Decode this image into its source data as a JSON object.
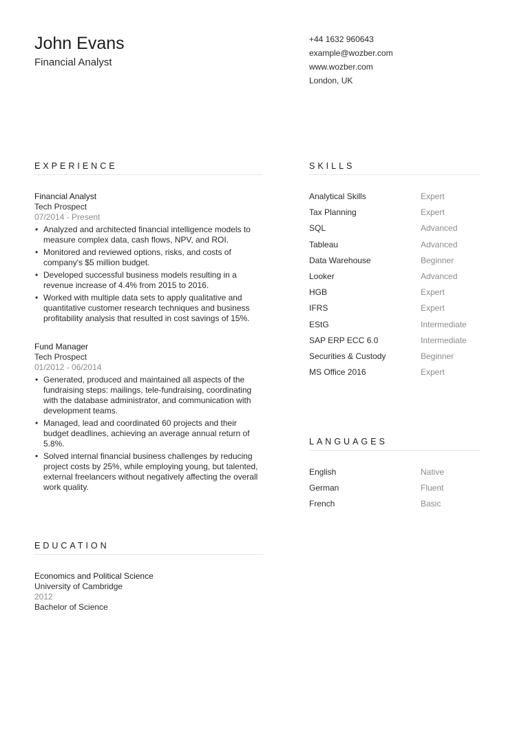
{
  "header": {
    "name": "John Evans",
    "title": "Financial Analyst",
    "contact": {
      "phone": "+44 1632 960643",
      "email": "example@wozber.com",
      "website": "www.wozber.com",
      "location": "London, UK"
    }
  },
  "experience": {
    "heading": "EXPERIENCE",
    "entries": [
      {
        "title": "Financial Analyst",
        "company": "Tech Prospect",
        "dates": "07/2014 - Present",
        "bullets": [
          "Analyzed and architected financial intelligence models to measure complex data, cash flows, NPV, and ROI.",
          "Monitored and reviewed options, risks, and costs of company's $5 million budget.",
          "Developed successful business models resulting in a revenue increase of 4.4% from 2015 to 2016.",
          "Worked with multiple data sets to apply qualitative and quantitative customer research techniques and business profitability analysis that resulted in cost savings of 15%."
        ]
      },
      {
        "title": "Fund Manager",
        "company": "Tech Prospect",
        "dates": "01/2012 - 06/2014",
        "bullets": [
          "Generated, produced and maintained all aspects of the fundraising steps: mailings, tele-fundraising, coordinating with the database administrator, and communication with development teams.",
          "Managed, lead and coordinated 60 projects and their budget deadlines, achieving an average annual return of 5.8%.",
          "Solved internal financial business challenges by reducing project costs by 25%, while employing young, but talented, external freelancers without negatively affecting the overall work quality."
        ]
      }
    ]
  },
  "education": {
    "heading": "EDUCATION",
    "entries": [
      {
        "field": "Economics and Political Science",
        "school": "University of Cambridge",
        "year": "2012",
        "degree": "Bachelor of Science"
      }
    ]
  },
  "skills": {
    "heading": "SKILLS",
    "items": [
      {
        "name": "Analytical Skills",
        "level": "Expert"
      },
      {
        "name": "Tax Planning",
        "level": "Expert"
      },
      {
        "name": "SQL",
        "level": "Advanced"
      },
      {
        "name": "Tableau",
        "level": "Advanced"
      },
      {
        "name": "Data Warehouse",
        "level": "Beginner"
      },
      {
        "name": "Looker",
        "level": "Advanced"
      },
      {
        "name": "HGB",
        "level": "Expert"
      },
      {
        "name": "IFRS",
        "level": "Expert"
      },
      {
        "name": "EStG",
        "level": "Intermediate"
      },
      {
        "name": "SAP ERP ECC 6.0",
        "level": "Intermediate"
      },
      {
        "name": "Securities & Custody",
        "level": "Beginner"
      },
      {
        "name": "MS Office 2016",
        "level": "Expert"
      }
    ]
  },
  "languages": {
    "heading": "LANGUAGES",
    "items": [
      {
        "name": "English",
        "level": "Native"
      },
      {
        "name": "German",
        "level": "Fluent"
      },
      {
        "name": "French",
        "level": "Basic"
      }
    ]
  }
}
